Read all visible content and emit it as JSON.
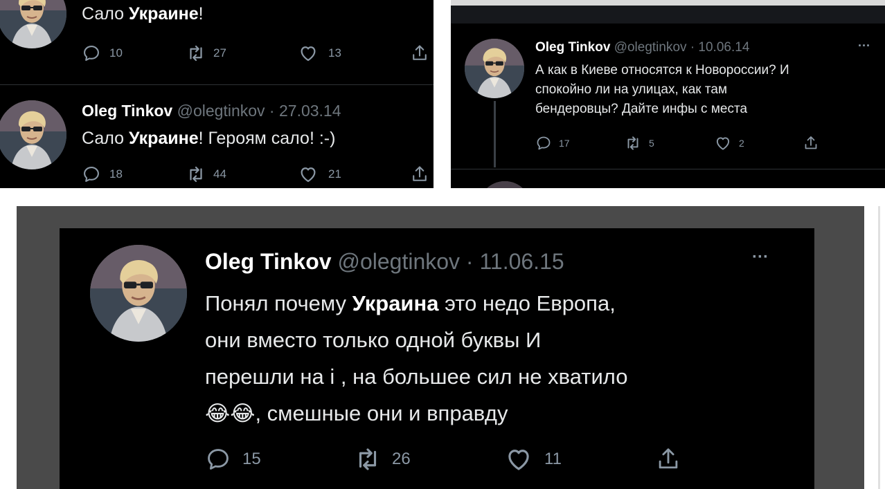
{
  "tweets": {
    "t1": {
      "text_pre": "Сало ",
      "text_bold": "Украине",
      "text_post": "!",
      "replies": "10",
      "retweets": "27",
      "likes": "13"
    },
    "t2": {
      "name": "Oleg Tinkov",
      "handle": "@olegtinkov",
      "sep": "·",
      "date": "27.03.14",
      "text_pre": "Сало ",
      "text_bold": "Украине",
      "text_post": "! Героям сало! :-)",
      "replies": "18",
      "retweets": "44",
      "likes": "21"
    },
    "t3": {
      "name": "Oleg Tinkov",
      "handle": "@olegtinkov",
      "sep": "·",
      "date": "10.06.14",
      "more": "···",
      "line1": "А как в Киеве относятся к Новороссии? И",
      "line2": "спокойно ли на улицах, как там",
      "line3": "бендеровцы? Дайте инфы с места",
      "replies": "17",
      "retweets": "5",
      "likes": "2"
    },
    "t4": {
      "name": "Oleg Tinkov",
      "handle": "@olegtinkov",
      "sep": "·",
      "date": "11.06.15",
      "more": "···",
      "line1_pre": "Понял почему ",
      "line1_bold": "Украина",
      "line1_post": " это недо Европа,",
      "line2": "они вместо только одной буквы И",
      "line3": "перешли на і , на большее сил не хватило",
      "line4_emoji": "😂😂",
      "line4_post": ", смешные они и вправду",
      "replies": "15",
      "retweets": "26",
      "likes": "11"
    }
  },
  "icons": [
    "reply-icon",
    "retweet-icon",
    "like-icon",
    "share-icon",
    "more-icon"
  ],
  "colors": {
    "background": "#000000",
    "text": "#e7e9ea",
    "muted": "#6e767d",
    "frame": "#4a4a4a"
  }
}
